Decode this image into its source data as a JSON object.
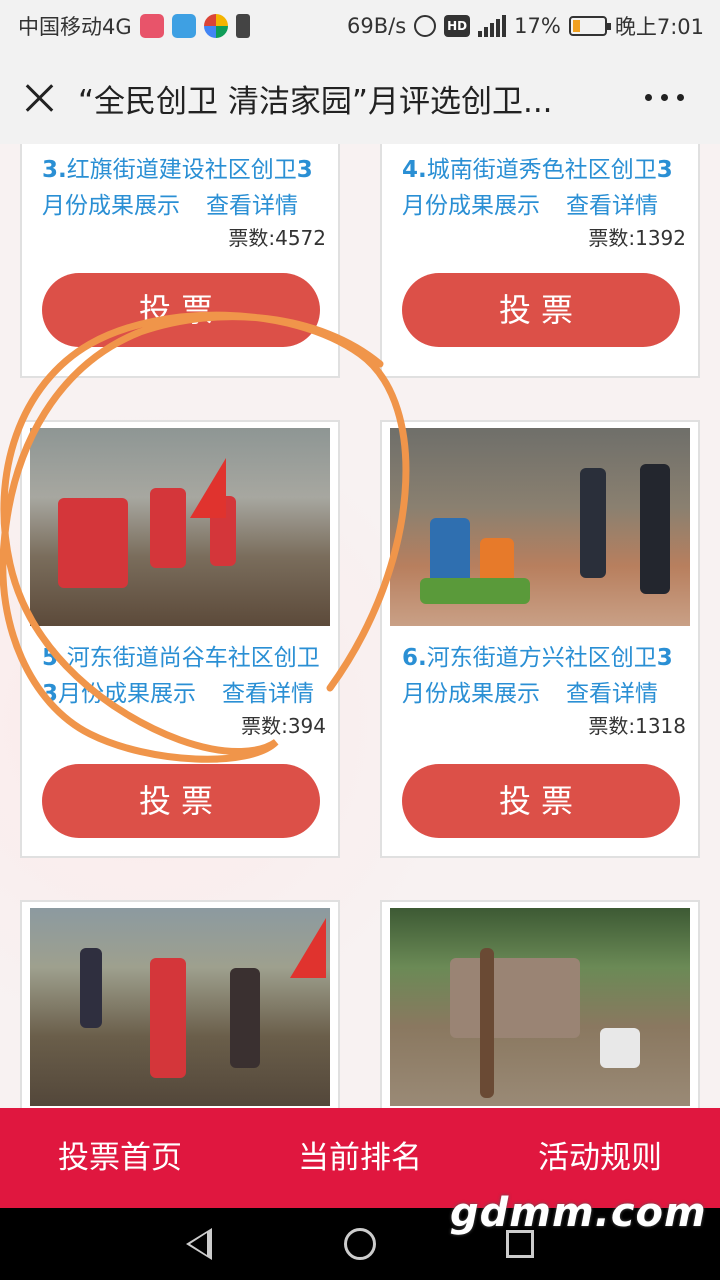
{
  "status_bar": {
    "carrier": "中国移动4G",
    "speed": "69B/s",
    "hd": "HD",
    "battery": "17%",
    "time": "晚上7:01"
  },
  "header": {
    "title": "“全民创卫 清洁家园”月评选创卫..."
  },
  "cards": [
    {
      "num": "3.",
      "title_line1": "红旗街道建设社区创卫",
      "title_line1_num": "3",
      "title_line2": "月份成果展示",
      "detail": "查看详情",
      "votes": "票数:4572",
      "vote_label": "投票"
    },
    {
      "num": "4.",
      "title_line1": "城南街道秀色社区创卫",
      "title_line1_num": "3",
      "title_line2": "月份成果展示",
      "detail": "查看详情",
      "votes": "票数:1392",
      "vote_label": "投票"
    },
    {
      "num": "5.",
      "title_line1": "河东街道尚谷车社区创卫",
      "title_line1_num": "",
      "title_line2": "月份成果展示",
      "title_line2_num": "3",
      "detail": "查看详情",
      "votes": "票数:394",
      "vote_label": "投票"
    },
    {
      "num": "6.",
      "title_line1": "河东街道方兴社区创卫",
      "title_line1_num": "3",
      "title_line2": "月份成果展示",
      "detail": "查看详情",
      "votes": "票数:1318",
      "vote_label": "投票"
    }
  ],
  "bottom_nav": {
    "items": [
      "投票首页",
      "当前排名",
      "活动规则"
    ]
  },
  "watermark": "gdmm.com",
  "colors": {
    "accent_red": "#dc5048",
    "nav_red": "#e0173f",
    "link_blue": "#2a8fd4",
    "annotation_orange": "#f0954a"
  }
}
